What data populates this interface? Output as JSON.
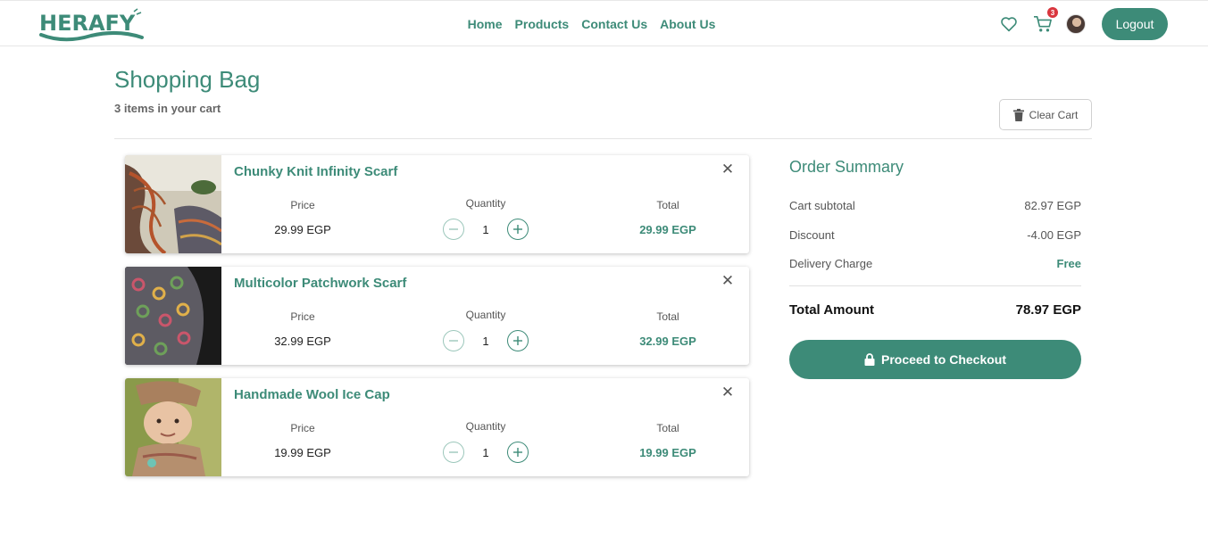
{
  "brand": {
    "logo_text": "HERAFY"
  },
  "nav": {
    "links": [
      {
        "label": "Home"
      },
      {
        "label": "Products"
      },
      {
        "label": "Contact Us"
      },
      {
        "label": "About Us"
      }
    ],
    "cart_count": "3",
    "logout_label": "Logout"
  },
  "page": {
    "title": "Shopping Bag",
    "items_count": "3 items in your cart",
    "clear_cart_label": "Clear Cart"
  },
  "cart": {
    "price_label": "Price",
    "quantity_label": "Quantity",
    "total_label": "Total",
    "remove_symbol": "✕",
    "items": [
      {
        "name": "Chunky Knit Infinity Scarf",
        "price": "29.99 EGP",
        "quantity": "1",
        "total": "29.99 EGP",
        "image": "knit-scarf-photo"
      },
      {
        "name": "Multicolor Patchwork Scarf",
        "price": "32.99 EGP",
        "quantity": "1",
        "total": "32.99 EGP",
        "image": "patchwork-scarf-photo"
      },
      {
        "name": "Handmade Wool Ice Cap",
        "price": "19.99 EGP",
        "quantity": "1",
        "total": "19.99 EGP",
        "image": "wool-cap-photo"
      }
    ]
  },
  "summary": {
    "title": "Order Summary",
    "subtotal_label": "Cart subtotal",
    "subtotal_value": "82.97 EGP",
    "discount_label": "Discount",
    "discount_value": "-4.00 EGP",
    "delivery_label": "Delivery Charge",
    "delivery_value": "Free",
    "total_label": "Total Amount",
    "total_value": "78.97 EGP",
    "checkout_label": "Proceed to Checkout"
  },
  "colors": {
    "accent": "#3d8b78",
    "badge": "#d9363e"
  }
}
